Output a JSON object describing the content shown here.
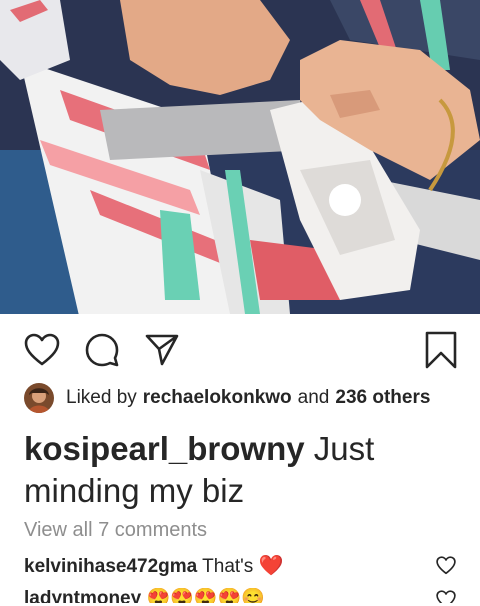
{
  "post": {
    "image_alt_icon": "photo-child-hands-car-seat-buckle",
    "actions": {
      "like_icon": "heart-outline-icon",
      "comment_icon": "comment-bubble-icon",
      "share_icon": "paper-plane-icon",
      "save_icon": "bookmark-icon"
    },
    "likes": {
      "prefix": "Liked by",
      "user": "rechaelokonkwo",
      "joiner": "and",
      "others": "236 others"
    },
    "caption": {
      "username": "kosipearl_browny",
      "text": "Just minding my biz"
    },
    "view_all": "View all 7 comments",
    "comments": [
      {
        "username": "kelvinihase472gma",
        "text": "That's",
        "emoji": "❤️"
      },
      {
        "username": "ladyntmoney",
        "text": "",
        "emoji": "😍😍😍😍😊"
      }
    ]
  },
  "colors": {
    "text": "#262626",
    "muted": "#8e8e8e",
    "heart": "#e0162b"
  }
}
